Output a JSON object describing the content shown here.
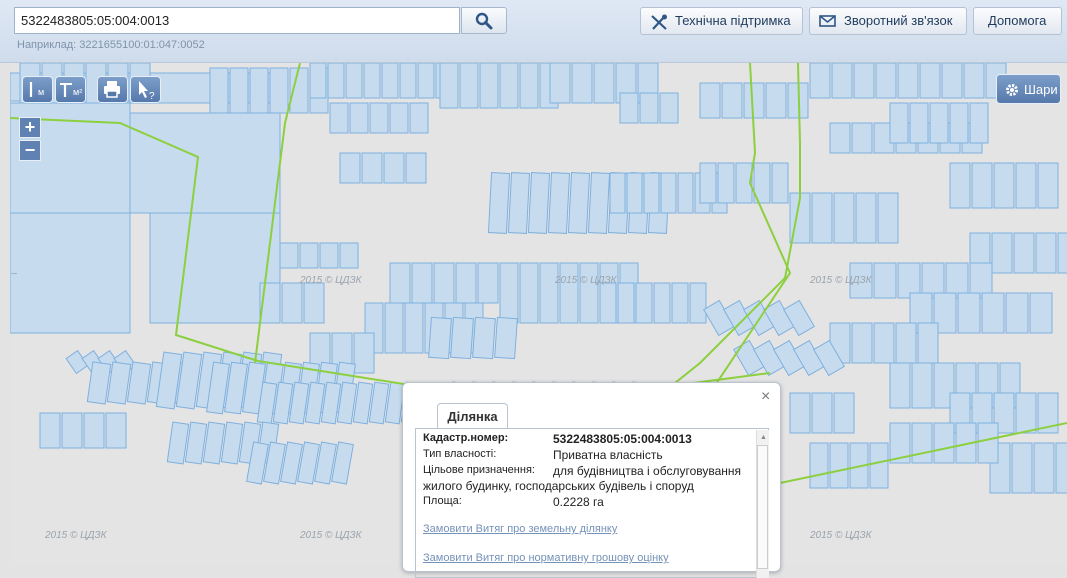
{
  "search": {
    "value": "5322483805:05:004:0013",
    "example": "Наприклад: 3221655100:01:047:0052"
  },
  "header_buttons": {
    "support": "Технічна підтримка",
    "feedback": "Зворотний зв'язок",
    "help": "Допомога"
  },
  "map": {
    "layers_label": "Шари",
    "zoom_in": "+",
    "zoom_out": "−",
    "watermark": "2015 © ЦДЗК",
    "tools": {
      "measure_distance_unit": "м",
      "measure_area_unit": "м²"
    },
    "colors": {
      "parcel_fill": "#c6dcee",
      "parcel_stroke": "#7fb0de",
      "boundary": "#8ccf3f"
    }
  },
  "popup": {
    "tab_label": "Ділянка",
    "close": "×",
    "fields": [
      {
        "label": "Кадастр.номер:",
        "value": "5322483805:05:004:0013"
      },
      {
        "label": "Тип власності:",
        "value": "Приватна власність"
      },
      {
        "label": "Цільове призначення:",
        "value": "для будівництва і обслуговування"
      },
      {
        "label": "Площа:",
        "value": "0.2228 га"
      }
    ],
    "purpose_continuation": "жилого будинку, господарських будівель і споруд",
    "links": [
      "Замовити Витяг про земельну ділянку",
      "Замовити Витяг про нормативну грошову оцінку"
    ]
  }
}
